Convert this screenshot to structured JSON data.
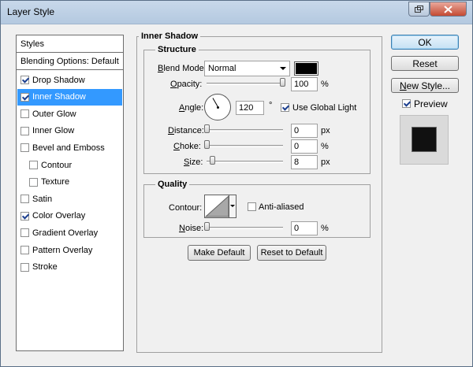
{
  "window": {
    "title": "Layer Style",
    "restore_icon": "restore-icon",
    "close_icon": "close-icon"
  },
  "sidebar": {
    "header": "Styles",
    "blending_options": "Blending Options: Default",
    "items": [
      {
        "label": "Drop Shadow",
        "checked": true,
        "selected": false,
        "sub": false
      },
      {
        "label": "Inner Shadow",
        "checked": true,
        "selected": true,
        "sub": false
      },
      {
        "label": "Outer Glow",
        "checked": false,
        "selected": false,
        "sub": false
      },
      {
        "label": "Inner Glow",
        "checked": false,
        "selected": false,
        "sub": false
      },
      {
        "label": "Bevel and Emboss",
        "checked": false,
        "selected": false,
        "sub": false
      },
      {
        "label": "Contour",
        "checked": false,
        "selected": false,
        "sub": true
      },
      {
        "label": "Texture",
        "checked": false,
        "selected": false,
        "sub": true
      },
      {
        "label": "Satin",
        "checked": false,
        "selected": false,
        "sub": false
      },
      {
        "label": "Color Overlay",
        "checked": true,
        "selected": false,
        "sub": false
      },
      {
        "label": "Gradient Overlay",
        "checked": false,
        "selected": false,
        "sub": false
      },
      {
        "label": "Pattern Overlay",
        "checked": false,
        "selected": false,
        "sub": false
      },
      {
        "label": "Stroke",
        "checked": false,
        "selected": false,
        "sub": false
      }
    ]
  },
  "panel": {
    "title": "Inner Shadow",
    "structure": {
      "title": "Structure",
      "blend_mode_label": "Blend Mode:",
      "blend_mode_value": "Normal",
      "shadow_color": "#000000",
      "opacity_label": "Opacity:",
      "opacity_value": "100",
      "opacity_unit": "%",
      "opacity_level": 1.0,
      "angle_label": "Angle:",
      "angle_value": "120",
      "angle_unit": "°",
      "use_global_light_label": "Use Global Light",
      "use_global_light_checked": true,
      "distance_label": "Distance:",
      "distance_value": "0",
      "distance_unit": "px",
      "choke_label": "Choke:",
      "choke_value": "0",
      "choke_unit": "%",
      "size_label": "Size:",
      "size_value": "8",
      "size_unit": "px"
    },
    "quality": {
      "title": "Quality",
      "contour_label": "Contour:",
      "anti_aliased_label": "Anti-aliased",
      "anti_aliased_checked": false,
      "noise_label": "Noise:",
      "noise_value": "0",
      "noise_unit": "%"
    },
    "make_default": "Make Default",
    "reset_to_default": "Reset to Default"
  },
  "actions": {
    "ok": "OK",
    "reset": "Reset",
    "new_style": "New Style...",
    "preview_label": "Preview",
    "preview_checked": true
  }
}
